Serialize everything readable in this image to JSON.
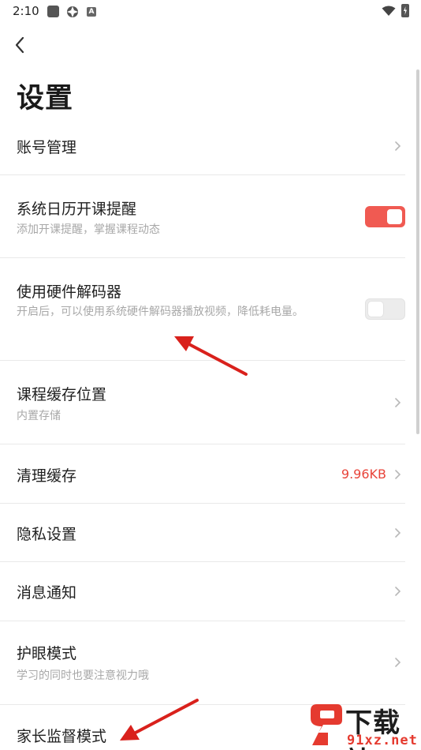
{
  "status_bar": {
    "time": "2:10"
  },
  "header": {
    "title": "设置"
  },
  "settings": {
    "account": {
      "title": "账号管理"
    },
    "calendar": {
      "title": "系统日历开课提醒",
      "subtitle": "添加开课提醒，掌握课程动态",
      "enabled": true
    },
    "hw_decoder": {
      "title": "使用硬件解码器",
      "subtitle": "开启后，可以使用系统硬件解码器播放视频，降低耗电量。",
      "enabled": false
    },
    "cache_location": {
      "title": "课程缓存位置",
      "subtitle": "内置存储"
    },
    "clear_cache": {
      "title": "清理缓存",
      "value": "9.96KB"
    },
    "privacy": {
      "title": "隐私设置"
    },
    "notifications": {
      "title": "消息通知"
    },
    "eye_care": {
      "title": "护眼模式",
      "subtitle": "学习的同时也要注意视力哦"
    },
    "parental": {
      "title": "家长监督模式"
    }
  },
  "watermark": {
    "text_top": "下载站",
    "text_bottom": "91xz.net"
  },
  "colors": {
    "accent": "#f05a52",
    "value_red": "#e8443a",
    "annotation_arrow": "#d9211c"
  }
}
